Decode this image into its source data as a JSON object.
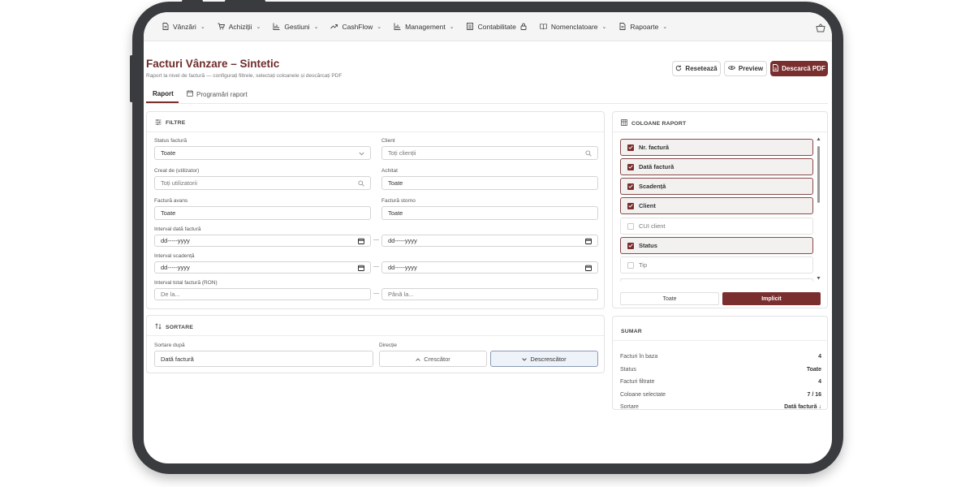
{
  "nav": {
    "items": [
      {
        "label": "Vânzări",
        "icon": "document-icon"
      },
      {
        "label": "Achiziții",
        "icon": "cart-icon"
      },
      {
        "label": "Gestiuni",
        "icon": "bar-chart-icon"
      },
      {
        "label": "CashFlow",
        "icon": "trend-icon"
      },
      {
        "label": "Management",
        "icon": "bar-chart-icon"
      },
      {
        "label": "Contabilitate",
        "icon": "ledger-icon"
      },
      {
        "label": "Nomenclatoare",
        "icon": "book-icon"
      },
      {
        "label": "Rapoarte",
        "icon": "document-icon"
      }
    ]
  },
  "header": {
    "title": "Facturi Vânzare – Sintetic",
    "subtitle": "Raport la nivel de factură — configurați filtrele, selectați coloanele și descărcați PDF",
    "reset_label": "Resetează",
    "preview_label": "Preview",
    "download_label": "Descarcă PDF"
  },
  "tabs": [
    {
      "label": "Raport",
      "active": true
    },
    {
      "label": "Programări raport",
      "active": false
    }
  ],
  "filters": {
    "heading": "FILTRE",
    "status_label": "Status factură",
    "status_value": "Toate",
    "client_label": "Client",
    "client_placeholder": "Toți clienții",
    "created_label": "Creat de (utilizator)",
    "created_placeholder": "Toți utilizatorii",
    "paid_label": "Achitat",
    "paid_value": "Toate",
    "advance_label": "Factură avans",
    "advance_value": "Toate",
    "storno_label": "Factură storno",
    "storno_value": "Toate",
    "date_label": "Interval dată factură",
    "due_label": "Interval scadență",
    "date_placeholder": "dd-----yyyy",
    "total_label": "Interval total factură (RON)",
    "from_placeholder": "De la...",
    "to_placeholder": "Până la...",
    "separator": "—"
  },
  "sorting": {
    "heading": "SORTARE",
    "sort_by_label": "Sortare după",
    "sort_by_value": "Dată factură",
    "direction_label": "Direcție",
    "asc_label": "Crescător",
    "desc_label": "Descrescător",
    "active": "desc"
  },
  "columns": {
    "heading": "COLOANE RAPORT",
    "items": [
      {
        "label": "Nr. factură",
        "checked": true
      },
      {
        "label": "Dată factură",
        "checked": true
      },
      {
        "label": "Scadență",
        "checked": true
      },
      {
        "label": "Client",
        "checked": true
      },
      {
        "label": "CUI client",
        "checked": false
      },
      {
        "label": "Status",
        "checked": true
      },
      {
        "label": "Tip",
        "checked": false
      }
    ],
    "all_label": "Toate",
    "default_label": "Implicit"
  },
  "summary": {
    "heading": "SUMAR",
    "rows": [
      {
        "label": "Facturi în baza",
        "value": "4"
      },
      {
        "label": "Status",
        "value": "Toate"
      },
      {
        "label": "Facturi filtrate",
        "value": "4"
      },
      {
        "label": "Coloane selectate",
        "value": "7 / 16"
      },
      {
        "label": "Sortare",
        "value": "Dată factură ↓"
      }
    ]
  },
  "colors": {
    "accent": "#7a2e2e",
    "frame": "#3a3b3f"
  }
}
